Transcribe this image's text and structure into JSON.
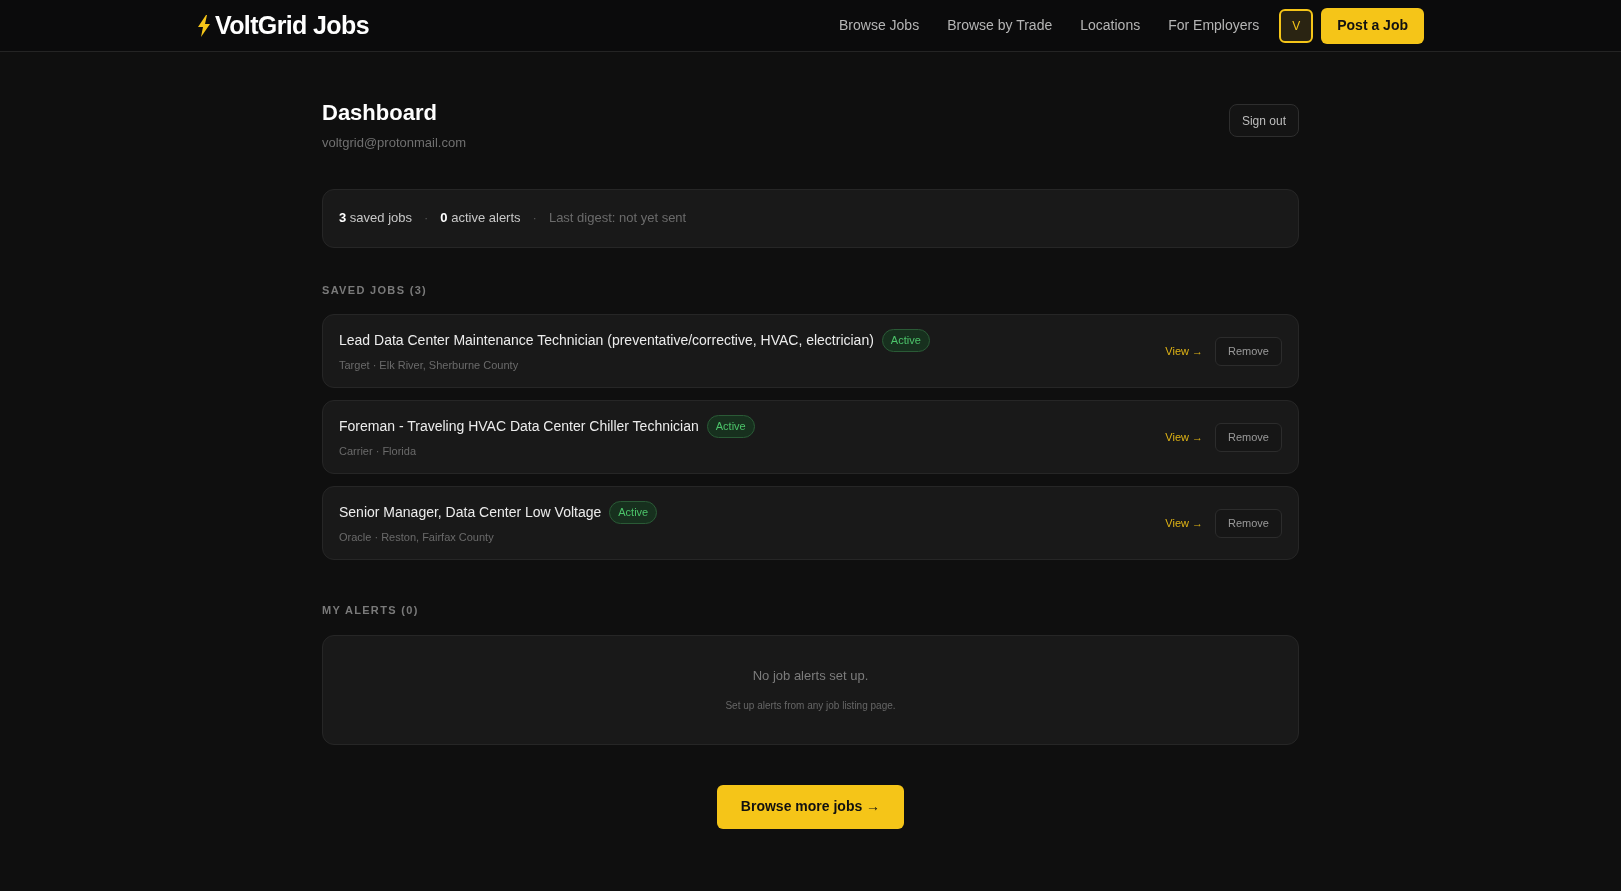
{
  "header": {
    "logo": "VoltGrid Jobs",
    "nav": [
      "Browse Jobs",
      "Browse by Trade",
      "Locations",
      "For Employers"
    ],
    "avatar": "V",
    "post_button": "Post a Job"
  },
  "dashboard": {
    "title": "Dashboard",
    "email": "voltgrid@protonmail.com",
    "sign_out": "Sign out"
  },
  "stats": [
    {
      "kind": "count",
      "text": "**3** saved jobs"
    },
    {
      "kind": "separator",
      "text": "·"
    },
    {
      "kind": "count",
      "text": "**0** active alerts"
    },
    {
      "kind": "separator",
      "text": "·"
    },
    {
      "kind": "note",
      "text": "Last digest: not yet sent"
    }
  ],
  "saved_jobs": {
    "heading": "SAVED JOBS (3)",
    "jobs": [
      {
        "title": "Lead Data Center Maintenance Technician (preventative/corrective, HVAC, electrician)",
        "status": "Active",
        "meta": "Target · Elk River, Sherburne County",
        "view": "View →",
        "remove": "Remove"
      },
      {
        "title": "Foreman - Traveling HVAC Data Center Chiller Technician",
        "status": "Active",
        "meta": "Carrier · Florida",
        "view": "View →",
        "remove": "Remove"
      },
      {
        "title": "Senior Manager, Data Center Low Voltage",
        "status": "Active",
        "meta": "Oracle · Reston, Fairfax County",
        "view": "View →",
        "remove": "Remove"
      }
    ]
  },
  "alerts": {
    "heading": "MY ALERTS (0)",
    "empty_title": "No job alerts set up.",
    "empty_hint": "Set up alerts from any job listing page."
  },
  "browse_button": "Browse more jobs →"
}
